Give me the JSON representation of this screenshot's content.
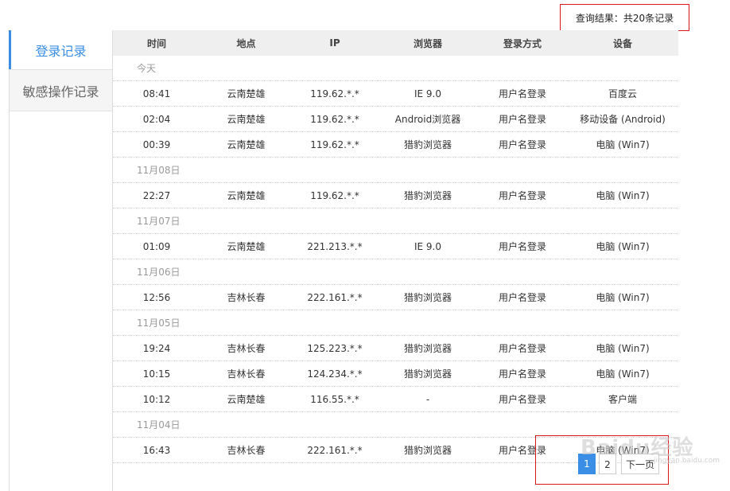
{
  "result": {
    "text": "查询结果：共20条记录"
  },
  "sidebar": {
    "items": [
      {
        "label": "登录记录",
        "active": true
      },
      {
        "label": "敏感操作记录",
        "active": false
      }
    ]
  },
  "table": {
    "headers": [
      "时间",
      "地点",
      "IP",
      "浏览器",
      "登录方式",
      "设备"
    ],
    "rows": [
      {
        "type": "date",
        "label": "今天"
      },
      {
        "type": "row",
        "cells": [
          "08:41",
          "云南楚雄",
          "119.62.*.*",
          "IE 9.0",
          "用户名登录",
          "百度云"
        ]
      },
      {
        "type": "row",
        "cells": [
          "02:04",
          "云南楚雄",
          "119.62.*.*",
          "Android浏览器",
          "用户名登录",
          "移动设备 (Android)"
        ]
      },
      {
        "type": "row",
        "cells": [
          "00:39",
          "云南楚雄",
          "119.62.*.*",
          "猎豹浏览器",
          "用户名登录",
          "电脑 (Win7)"
        ]
      },
      {
        "type": "date",
        "label": "11月08日"
      },
      {
        "type": "row",
        "cells": [
          "22:27",
          "云南楚雄",
          "119.62.*.*",
          "猎豹浏览器",
          "用户名登录",
          "电脑 (Win7)"
        ]
      },
      {
        "type": "date",
        "label": "11月07日"
      },
      {
        "type": "row",
        "cells": [
          "01:09",
          "云南楚雄",
          "221.213.*.*",
          "IE 9.0",
          "用户名登录",
          "电脑 (Win7)"
        ]
      },
      {
        "type": "date",
        "label": "11月06日"
      },
      {
        "type": "row",
        "cells": [
          "12:56",
          "吉林长春",
          "222.161.*.*",
          "猎豹浏览器",
          "用户名登录",
          "电脑 (Win7)"
        ]
      },
      {
        "type": "date",
        "label": "11月05日"
      },
      {
        "type": "row",
        "cells": [
          "19:24",
          "吉林长春",
          "125.223.*.*",
          "猎豹浏览器",
          "用户名登录",
          "电脑 (Win7)"
        ]
      },
      {
        "type": "row",
        "cells": [
          "10:15",
          "吉林长春",
          "124.234.*.*",
          "猎豹浏览器",
          "用户名登录",
          "电脑 (Win7)"
        ]
      },
      {
        "type": "row",
        "cells": [
          "10:12",
          "云南楚雄",
          "116.55.*.*",
          "-",
          "用户名登录",
          "客户端"
        ]
      },
      {
        "type": "date",
        "label": "11月04日"
      },
      {
        "type": "row",
        "cells": [
          "16:43",
          "吉林长春",
          "222.161.*.*",
          "猎豹浏览器",
          "用户名登录",
          "电脑 (Win7)"
        ]
      }
    ]
  },
  "pagination": {
    "current": "1",
    "page2": "2",
    "next": "下一页"
  },
  "watermark": {
    "text": "Baidu经验",
    "sub": "jingyan.baidu.com"
  },
  "colors": {
    "accent": "#3a8ee6",
    "highlight_border": "#d9171b",
    "header_bg": "#efefef"
  }
}
